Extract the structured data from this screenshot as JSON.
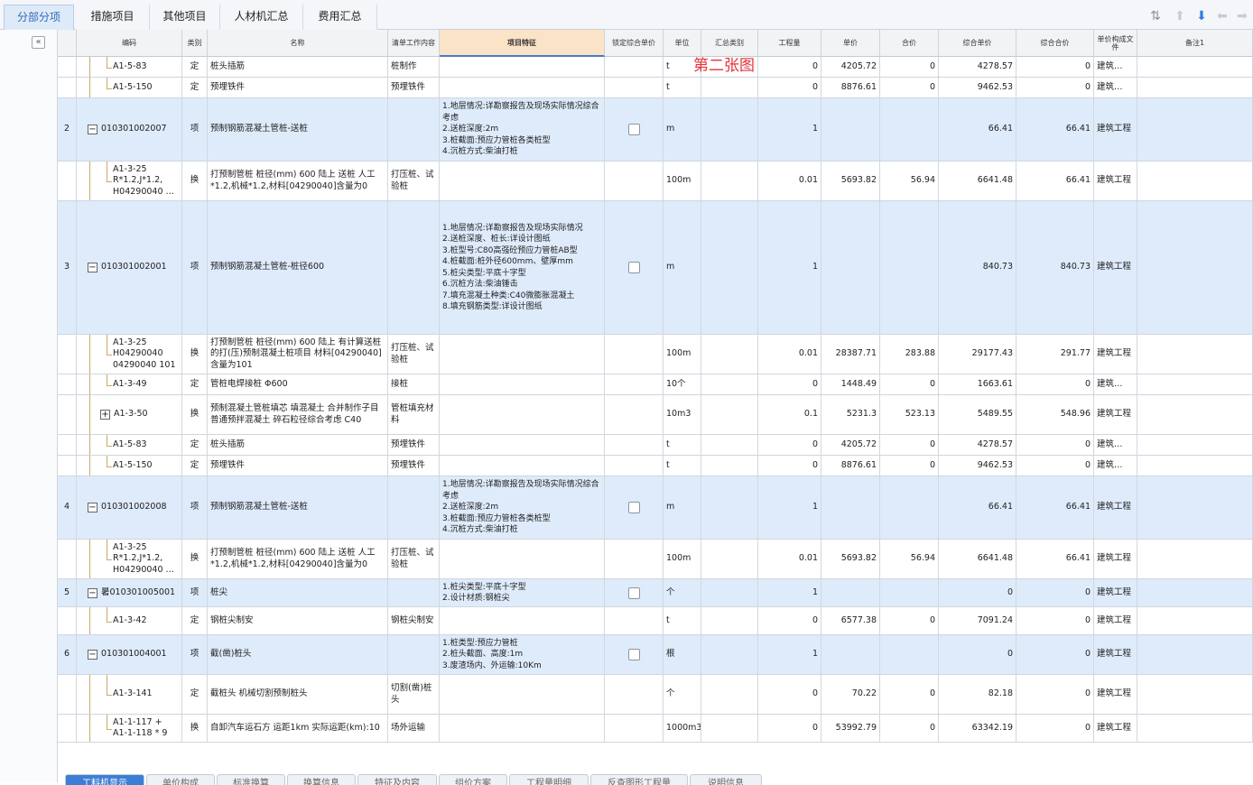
{
  "tabs": [
    "分部分项",
    "措施项目",
    "其他项目",
    "人材机汇总",
    "费用汇总"
  ],
  "toolbar_icons": [
    "sort-icon",
    "arrow-up-icon",
    "arrow-down-icon",
    "arrow-left-icon",
    "arrow-right-icon"
  ],
  "collapse_label": "«",
  "columns": [
    "",
    "编码",
    "类别",
    "名称",
    "清单工作内容",
    "项目特征",
    "锁定综合单价",
    "单位",
    "汇总类别",
    "工程量",
    "单价",
    "合价",
    "综合单价",
    "综合合价",
    "单价构成文件",
    "备注1"
  ],
  "overlay_text": "第二张图",
  "rows": [
    {
      "num": "",
      "tree": "line",
      "code": "A1-5-83",
      "type": "定",
      "name": "桩头插筋",
      "work": "桩制作",
      "feat": "",
      "chk": false,
      "unit": "t",
      "cat": "",
      "qty": "0",
      "price": "4205.72",
      "total": "0",
      "cprice": "4278.57",
      "ctotal": "0",
      "file": "建筑…"
    },
    {
      "num": "",
      "tree": "line",
      "code": "A1-5-150",
      "type": "定",
      "name": "预埋铁件",
      "work": "预埋铁件",
      "feat": "",
      "chk": false,
      "unit": "t",
      "cat": "",
      "qty": "0",
      "price": "8876.61",
      "total": "0",
      "cprice": "9462.53",
      "ctotal": "0",
      "file": "建筑…"
    },
    {
      "num": "2",
      "tree": "minus",
      "code": "010301002007",
      "type": "项",
      "name": "预制钢筋混凝土管桩-送桩",
      "work": "",
      "feat": "1.地层情况:详勘察报告及现场实际情况综合考虑\n2.送桩深度:2m\n3.桩截面:预应力管桩各类桩型\n4.沉桩方式:柴油打桩",
      "chk": true,
      "unit": "m",
      "cat": "",
      "qty": "1",
      "price": "",
      "total": "",
      "cprice": "66.41",
      "ctotal": "66.41",
      "file": "建筑工程"
    },
    {
      "num": "",
      "tree": "line",
      "code": "A1-3-25\nR*1.2,J*1.2,\nH04290040 …",
      "type": "换",
      "name": "打预制管桩 桩径(mm) 600 陆上 送桩 人工*1.2,机械*1.2,材料[04290040]含量为0",
      "work": "打压桩、试验桩",
      "feat": "",
      "chk": false,
      "unit": "100m",
      "cat": "",
      "qty": "0.01",
      "price": "5693.82",
      "total": "56.94",
      "cprice": "6641.48",
      "ctotal": "66.41",
      "file": "建筑工程"
    },
    {
      "num": "3",
      "tree": "minus",
      "code": "010301002001",
      "type": "项",
      "name": "预制钢筋混凝土管桩-桩径600",
      "work": "",
      "feat": "1.地层情况:详勘察报告及现场实际情况\n2.送桩深度、桩长:详设计图纸\n3.桩型号:C80高强砼预应力管桩AB型\n4.桩截面:桩外径600mm、壁厚mm\n5.桩尖类型:平底十字型\n6.沉桩方法:柴油锤击\n7.填充混凝土种类:C40微膨胀混凝土\n8.填充钢筋类型:详设计图纸",
      "chk": true,
      "unit": "m",
      "cat": "",
      "qty": "1",
      "price": "",
      "total": "",
      "cprice": "840.73",
      "ctotal": "840.73",
      "file": "建筑工程"
    },
    {
      "num": "",
      "tree": "line",
      "code": "A1-3-25\nH04290040\n04290040 101",
      "type": "换",
      "name": "打预制管桩 桩径(mm) 600 陆上 有计算送桩的打(压)预制混凝土桩项目 材料[04290040] 含量为101",
      "work": "打压桩、试验桩",
      "feat": "",
      "chk": false,
      "unit": "100m",
      "cat": "",
      "qty": "0.01",
      "price": "28387.71",
      "total": "283.88",
      "cprice": "29177.43",
      "ctotal": "291.77",
      "file": "建筑工程"
    },
    {
      "num": "",
      "tree": "line",
      "code": "A1-3-49",
      "type": "定",
      "name": "管桩电焊接桩 Φ600",
      "work": "接桩",
      "feat": "",
      "chk": false,
      "unit": "10个",
      "cat": "",
      "qty": "0",
      "price": "1448.49",
      "total": "0",
      "cprice": "1663.61",
      "ctotal": "0",
      "file": "建筑…"
    },
    {
      "num": "",
      "tree": "plus",
      "code": "A1-3-50",
      "type": "换",
      "name": "预制混凝土管桩填芯 填混凝土 合并制作子目 普通预拌混凝土 碎石粒径综合考虑 C40",
      "work": "管桩填充材料",
      "feat": "",
      "chk": false,
      "unit": "10m3",
      "cat": "",
      "qty": "0.1",
      "price": "5231.3",
      "total": "523.13",
      "cprice": "5489.55",
      "ctotal": "548.96",
      "file": "建筑工程"
    },
    {
      "num": "",
      "tree": "line",
      "code": "A1-5-83",
      "type": "定",
      "name": "桩头插筋",
      "work": "预埋铁件",
      "feat": "",
      "chk": false,
      "unit": "t",
      "cat": "",
      "qty": "0",
      "price": "4205.72",
      "total": "0",
      "cprice": "4278.57",
      "ctotal": "0",
      "file": "建筑…"
    },
    {
      "num": "",
      "tree": "line",
      "code": "A1-5-150",
      "type": "定",
      "name": "预埋铁件",
      "work": "预埋铁件",
      "feat": "",
      "chk": false,
      "unit": "t",
      "cat": "",
      "qty": "0",
      "price": "8876.61",
      "total": "0",
      "cprice": "9462.53",
      "ctotal": "0",
      "file": "建筑…"
    },
    {
      "num": "4",
      "tree": "minus",
      "code": "010301002008",
      "type": "项",
      "name": "预制钢筋混凝土管桩-送桩",
      "work": "",
      "feat": "1.地层情况:详勘察报告及现场实际情况综合考虑\n2.送桩深度:2m\n3.桩截面:预应力管桩各类桩型\n4.沉桩方式:柴油打桩",
      "chk": true,
      "unit": "m",
      "cat": "",
      "qty": "1",
      "price": "",
      "total": "",
      "cprice": "66.41",
      "ctotal": "66.41",
      "file": "建筑工程"
    },
    {
      "num": "",
      "tree": "line",
      "code": "A1-3-25\nR*1.2,J*1.2,\nH04290040 …",
      "type": "换",
      "name": "打预制管桩 桩径(mm) 600 陆上 送桩 人工*1.2,机械*1.2,材料[04290040]含量为0",
      "work": "打压桩、试验桩",
      "feat": "",
      "chk": false,
      "unit": "100m",
      "cat": "",
      "qty": "0.01",
      "price": "5693.82",
      "total": "56.94",
      "cprice": "6641.48",
      "ctotal": "66.41",
      "file": "建筑工程"
    },
    {
      "num": "5",
      "tree": "minus",
      "code": "暑010301005001",
      "type": "项",
      "name": "桩尖",
      "work": "",
      "feat": "1.桩尖类型:平底十字型\n2.设计材质:钢桩尖",
      "chk": true,
      "unit": "个",
      "cat": "",
      "qty": "1",
      "price": "",
      "total": "",
      "cprice": "0",
      "ctotal": "0",
      "file": "建筑工程"
    },
    {
      "num": "",
      "tree": "line",
      "code": "A1-3-42",
      "type": "定",
      "name": "钢桩尖制安",
      "work": "钢桩尖制安",
      "feat": "",
      "chk": false,
      "unit": "t",
      "cat": "",
      "qty": "0",
      "price": "6577.38",
      "total": "0",
      "cprice": "7091.24",
      "ctotal": "0",
      "file": "建筑工程"
    },
    {
      "num": "6",
      "tree": "minus",
      "code": "010301004001",
      "type": "项",
      "name": "截(凿)桩头",
      "work": "",
      "feat": "1.桩类型:预应力管桩\n2.桩头截面、高度:1m\n3.废渣场内、外运输:10Km",
      "chk": true,
      "unit": "根",
      "cat": "",
      "qty": "1",
      "price": "",
      "total": "",
      "cprice": "0",
      "ctotal": "0",
      "file": "建筑工程"
    },
    {
      "num": "",
      "tree": "line",
      "code": "A1-3-141",
      "type": "定",
      "name": "截桩头 机械切割预制桩头",
      "work": "切割(凿)桩头",
      "feat": "",
      "chk": false,
      "unit": "个",
      "cat": "",
      "qty": "0",
      "price": "70.22",
      "total": "0",
      "cprice": "82.18",
      "ctotal": "0",
      "file": "建筑工程"
    },
    {
      "num": "",
      "tree": "line",
      "code": "A1-1-117 +\nA1-1-118 * 9",
      "type": "换",
      "name": "自卸汽车运石方 运距1km 实际运距(km):10",
      "work": "场外运输",
      "feat": "",
      "chk": false,
      "unit": "1000m3",
      "cat": "",
      "qty": "0",
      "price": "53992.79",
      "total": "0",
      "cprice": "63342.19",
      "ctotal": "0",
      "file": "建筑工程"
    }
  ],
  "bottom_tabs": [
    "工料机显示",
    "单价构成",
    "标准换算",
    "换算信息",
    "特征及内容",
    "组价方案",
    "工程量明细",
    "反查图形工程量",
    "说明信息"
  ]
}
